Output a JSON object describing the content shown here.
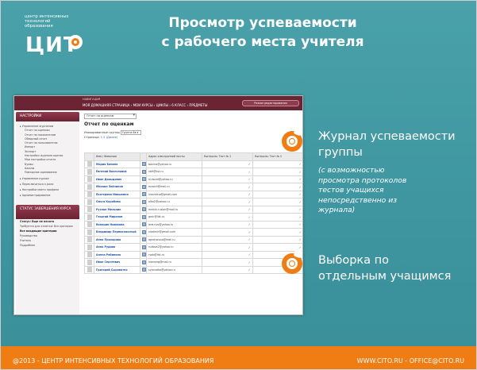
{
  "logo": {
    "small_text": "центр интенсивных технологий образования",
    "big_text": "ЦИТ"
  },
  "title_line1": "Просмотр успеваемости",
  "title_line2": "с рабочего места учителя",
  "screenshot": {
    "top_home": "НАВИГАЦИЯ",
    "top_menu": "МОЯ ДОМАШНЯЯ СТРАНИЦА › МОИ КУРСЫ › ЦИКЛЫ › 6 КЛАСС › ПРЕДМЕТЫ",
    "mode_button": "Режим редактирования",
    "side_head": "НАСТРОЙКИ",
    "side_items": [
      {
        "text": "▸ Управление журналом",
        "cls": ""
      },
      {
        "text": "Отчет по оценкам",
        "cls": "sub"
      },
      {
        "text": "Отчет по показателям",
        "cls": "sub"
      },
      {
        "text": "Обзорный отчет",
        "cls": "sub"
      },
      {
        "text": "Отчет по пользователю",
        "cls": "sub"
      },
      {
        "text": "Импорт",
        "cls": "sub"
      },
      {
        "text": "Экспорт",
        "cls": "sub"
      },
      {
        "text": "Настройки журнала оценок",
        "cls": "sub"
      },
      {
        "text": "Мои настройки отчета",
        "cls": "sub"
      },
      {
        "text": "Буквы",
        "cls": "sub"
      },
      {
        "text": "Шкалы",
        "cls": "sub"
      },
      {
        "text": "Повторное оценивание",
        "cls": "sub"
      },
      {
        "text": "▸ Управление курсом",
        "cls": "sec"
      },
      {
        "text": "▸ Переключиться к роли",
        "cls": "sec"
      },
      {
        "text": "▸ Настройки моего профиля",
        "cls": "sec"
      },
      {
        "text": "▸ Администрирование",
        "cls": "sec"
      }
    ],
    "side_head2": "СТАТУС ЗАВЕРШЕНИЯ КУРСА",
    "side_items2": [
      {
        "text": "Статус: Еще не начато",
        "cls": "strong"
      },
      {
        "text": "Требуется для отметки: Все критерии",
        "cls": ""
      },
      {
        "text": "Все входящие критерии",
        "cls": "strong"
      },
      {
        "text": "Руководство",
        "cls": ""
      },
      {
        "text": "Учитель",
        "cls": ""
      },
      {
        "text": "Подробнее",
        "cls": ""
      }
    ],
    "select_value": "Отчет по оценкам",
    "report_title": "Отчет по оценкам",
    "group_label": "Изолированные группы",
    "group_value": "Группа 6в ▾",
    "pages_label": "Страница:",
    "pages_links": "1  2  (Далее)",
    "col_name": "Имя / Фамилия",
    "col_email": "Адрес электронной почты",
    "col_cat": "Категория: Курс",
    "col_t1": "Контроль: Тест № 1",
    "col_t2": "Контроль: Тест № 2",
    "rows": [
      {
        "name": "Мария Бонина",
        "email": "bonina@yahoo.ru"
      },
      {
        "name": "Евгений Вячеславов",
        "email": "vb9@list.ru"
      },
      {
        "name": "Иван Давыдович",
        "email": "iv.david@yahoo.ru"
      },
      {
        "name": "Михаил Зайчиков",
        "email": "mzaich@mail.ru"
      },
      {
        "name": "Екатерина Ивашкина",
        "email": "ivashkina@gmail.com"
      },
      {
        "name": "Ольга Коробова",
        "email": "olko2@yahoo.ru"
      },
      {
        "name": "Руслан Мельник",
        "email": "melnik.ruslan@mail.ru"
      },
      {
        "name": "Георгий Миронов",
        "email": "gmir@list.ru"
      },
      {
        "name": "Валерия Новикова",
        "email": "lera.nov@yahoo.ru"
      },
      {
        "name": "Владимир Первоклассный",
        "email": "vladimir@gmail.com"
      },
      {
        "name": "Анна Прохорова",
        "email": "aprohorova@mail.ru"
      },
      {
        "name": "Анна Рудова",
        "email": "rudova2@yahoo.ru"
      },
      {
        "name": "Алена Рябинина",
        "email": "ryab@list.ru"
      },
      {
        "name": "Иван Сергеевич",
        "email": "ivanserg@mail.ru"
      },
      {
        "name": "Григорий Сыроватко",
        "email": "syrovatko@yahoo.ru"
      }
    ]
  },
  "bullets": [
    {
      "title_lines": [
        "Журнал успеваемости",
        "группы"
      ],
      "note_lines": [
        "(с    возможностью",
        "просмотра  протоколов",
        "тестов учащихся",
        "непосредственно из",
        "журнала)"
      ]
    },
    {
      "title_lines": [
        "Выборка по",
        "отдельным учащимся"
      ]
    }
  ],
  "footer": {
    "left": "@2013 - ЦЕНТР ИНТЕНСИВНЫХ ТЕХНОЛОГИЙ ОБРАЗОВАНИЯ",
    "right": "WWW.CITO.RU - OFFICE@CITO.RU"
  },
  "colors": {
    "background": "#4aa1a9",
    "accent": "#f07d14",
    "app_header": "#6b2433"
  }
}
